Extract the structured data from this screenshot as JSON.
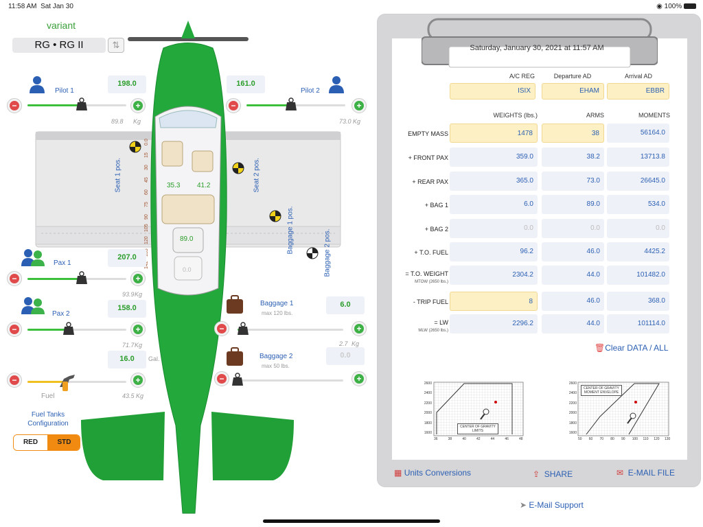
{
  "status": {
    "time": "11:58 AM",
    "date": "Sat Jan 30",
    "battery": "100%"
  },
  "variant": {
    "label": "variant",
    "value": "RG • RG II"
  },
  "pilot1": {
    "label": "Pilot 1",
    "value": "198.0",
    "kg": "89.8",
    "kg_unit": "Kg",
    "fill": 0.55
  },
  "pilot2": {
    "label": "Pilot 2",
    "value": "161.0",
    "kg": "73.0",
    "kg_unit": "Kg",
    "fill": 0.45
  },
  "pax1": {
    "label": "Pax 1",
    "value": "207.0",
    "kg": "93.9",
    "kg_unit": "Kg",
    "fill": 0.55
  },
  "pax2": {
    "label": "Pax 2",
    "value": "158.0",
    "kg": "71.7",
    "kg_unit": "Kg",
    "fill": 0.42
  },
  "fuel": {
    "label": "Fuel",
    "value": "16.0",
    "unit": "Gal.",
    "kg": "43.5",
    "kg_unit": "Kg",
    "fill": 0.4
  },
  "baggage1": {
    "label": "Baggage 1",
    "limit": "max 120 lbs.",
    "value": "6.0",
    "kg": "2.7",
    "kg_unit": "Kg",
    "fill": 0.05
  },
  "baggage2": {
    "label": "Baggage 2",
    "limit": "max 50 lbs.",
    "value": "0.0",
    "fill": 0.0
  },
  "fuel_tanks": {
    "label_line1": "Fuel Tanks",
    "label_line2": "Configuration",
    "option_red": "RED",
    "option_std": "STD",
    "selected": "STD"
  },
  "seats": {
    "seat1_label": "Seat 1 pos.",
    "seat2_label": "Seat 2 pos.",
    "baggage1_label": "Baggage 1 pos.",
    "baggage2_label": "Baggage 2 pos.",
    "seat1_arm": "35.3",
    "seat2_arm": "41.2",
    "bag1_arm": "89.0",
    "bag2_arm": "0.0",
    "ruler": [
      "0.0",
      "15",
      "30",
      "45",
      "60",
      "75",
      "90",
      "105",
      "120",
      "135",
      "142"
    ]
  },
  "report": {
    "date": "Saturday, January 30, 2021 at 11:57 AM",
    "headers": {
      "ac_reg": "A/C REG",
      "departure": "Departure AD",
      "arrival": "Arrival AD"
    },
    "ac_reg": "ISIX",
    "departure": "EHAM",
    "arrival": "EBBR",
    "col_headers": {
      "weights": "WEIGHTS (lbs.)",
      "arms": "ARMS",
      "moments": "MOMENTS"
    },
    "rows": [
      {
        "label": "EMPTY MASS",
        "sub": "",
        "weight": "1478",
        "arm": "38",
        "moment": "56164.0"
      },
      {
        "label": "+ FRONT PAX",
        "sub": "",
        "weight": "359.0",
        "arm": "38.2",
        "moment": "13713.8"
      },
      {
        "label": "+ REAR PAX",
        "sub": "",
        "weight": "365.0",
        "arm": "73.0",
        "moment": "26645.0"
      },
      {
        "label": "+ BAG 1",
        "sub": "",
        "weight": "6.0",
        "arm": "89.0",
        "moment": "534.0"
      },
      {
        "label": "+ BAG 2",
        "sub": "",
        "weight": "0.0",
        "arm": "0.0",
        "moment": "0.0"
      },
      {
        "label": "+ T.O. FUEL",
        "sub": "",
        "weight": "96.2",
        "arm": "46.0",
        "moment": "4425.2"
      },
      {
        "label": "= T.O. WEIGHT",
        "sub": "MTOW (2650 lbs.)",
        "weight": "2304.2",
        "arm": "44.0",
        "moment": "101482.0"
      },
      {
        "label": "- TRIP FUEL",
        "sub": "",
        "weight": "8",
        "arm": "46.0",
        "moment": "368.0"
      },
      {
        "label": "= LW",
        "sub": "MLW (2650 lbs.)",
        "weight": "2296.2",
        "arm": "44.0",
        "moment": "101114.0"
      }
    ],
    "clear": "Clear DATA / ALL"
  },
  "envelope1": {
    "caption_line1": "CENTER OF GRAVITY",
    "caption_line2": "LIMITS",
    "y_ticks": [
      "2600",
      "2400",
      "2200",
      "2000",
      "1800",
      "1600"
    ],
    "x_ticks": [
      "36",
      "38",
      "40",
      "42",
      "44",
      "46",
      "48"
    ]
  },
  "envelope2": {
    "caption_line1": "CENTER OF GRAVITY",
    "caption_line2": "MOMENT ENVELOPE",
    "y_ticks": [
      "2600",
      "2400",
      "2200",
      "2000",
      "1800",
      "1600"
    ],
    "x_ticks": [
      "50",
      "60",
      "70",
      "80",
      "90",
      "100",
      "110",
      "120",
      "130"
    ]
  },
  "actions": {
    "units": "Units Conversions",
    "share": "SHARE",
    "email_file": "E-MAIL FILE",
    "email_support": "E-Mail Support"
  },
  "colors": {
    "accent_green": "#2a9d2a",
    "plane_green": "#22a33a",
    "link_blue": "#2b5fb3",
    "field_yellow": "#fdf0c4"
  }
}
